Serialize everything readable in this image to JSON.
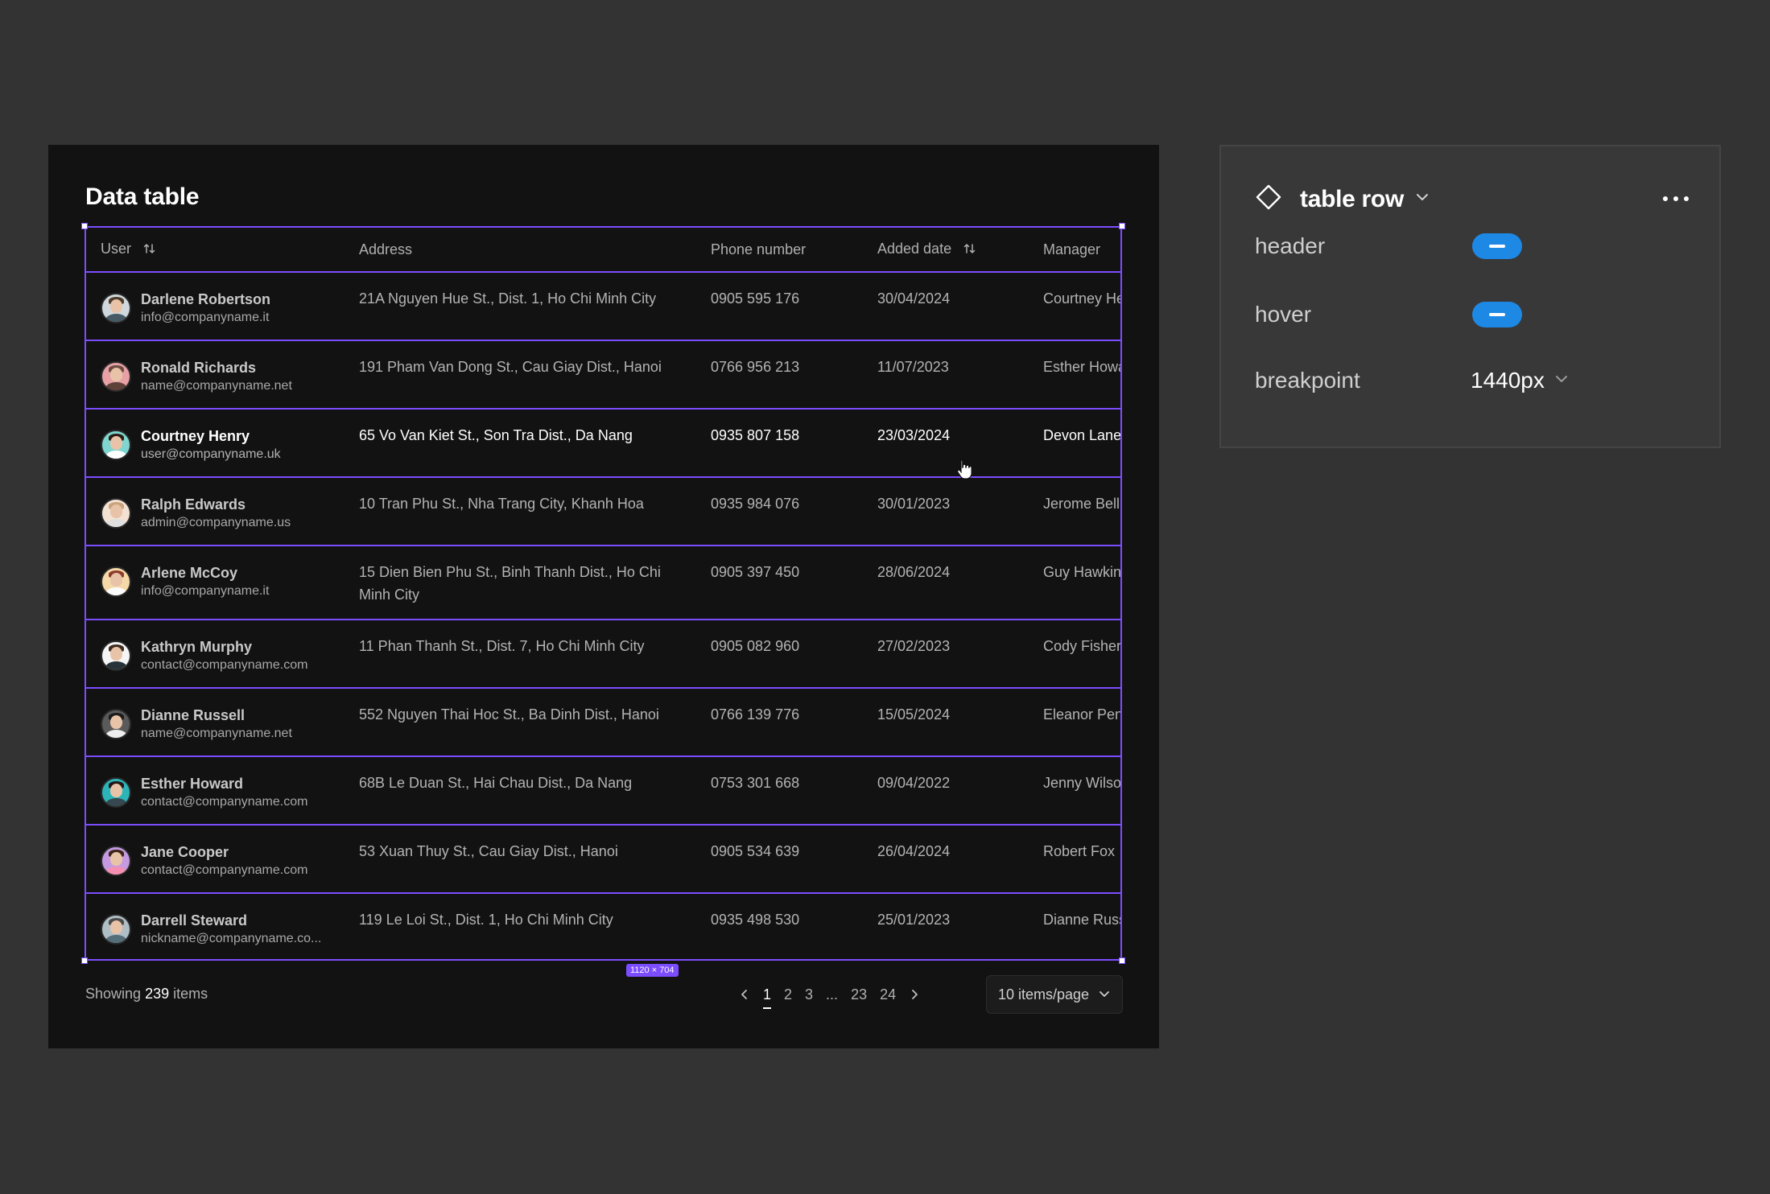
{
  "card": {
    "title": "Data table",
    "size_tag": "1120 × 704"
  },
  "table": {
    "columns": [
      "User",
      "Address",
      "Phone number",
      "Added date",
      "Manager"
    ],
    "sortable_columns": [
      "User",
      "Added date"
    ],
    "rows": [
      {
        "name": "Darlene Robertson",
        "email": "info@companyname.it",
        "address": "21A Nguyen Hue St., Dist. 1, Ho Chi Minh City",
        "phone": "0905 595 176",
        "date": "30/04/2024",
        "manager": "Courtney Henry"
      },
      {
        "name": "Ronald Richards",
        "email": "name@companyname.net",
        "address": "191 Pham Van Dong St., Cau Giay Dist., Hanoi",
        "phone": "0766 956 213",
        "date": "11/07/2023",
        "manager": "Esther Howard"
      },
      {
        "name": "Courtney Henry",
        "email": "user@companyname.uk",
        "address": "65 Vo Van Kiet St., Son Tra Dist., Da Nang",
        "phone": "0935 807 158",
        "date": "23/03/2024",
        "manager": "Devon Lane"
      },
      {
        "name": "Ralph Edwards",
        "email": "admin@companyname.us",
        "address": "10 Tran Phu St., Nha Trang City, Khanh Hoa",
        "phone": "0935 984 076",
        "date": "30/01/2023",
        "manager": "Jerome Bell"
      },
      {
        "name": "Arlene McCoy",
        "email": "info@companyname.it",
        "address": "15 Dien Bien Phu St., Binh Thanh Dist., Ho Chi Minh City",
        "phone": "0905 397 450",
        "date": "28/06/2024",
        "manager": "Guy Hawkins"
      },
      {
        "name": "Kathryn Murphy",
        "email": "contact@companyname.com",
        "address": "11 Phan Thanh St., Dist. 7, Ho Chi Minh City",
        "phone": "0905 082 960",
        "date": "27/02/2023",
        "manager": "Cody Fisher"
      },
      {
        "name": "Dianne Russell",
        "email": "name@companyname.net",
        "address": "552 Nguyen Thai Hoc St., Ba Dinh Dist., Hanoi",
        "phone": "0766 139 776",
        "date": "15/05/2024",
        "manager": "Eleanor Pena"
      },
      {
        "name": "Esther Howard",
        "email": "contact@companyname.com",
        "address": "68B Le Duan St., Hai Chau Dist., Da Nang",
        "phone": "0753 301 668",
        "date": "09/04/2022",
        "manager": "Jenny Wilson"
      },
      {
        "name": "Jane Cooper",
        "email": "contact@companyname.com",
        "address": "53 Xuan Thuy St., Cau Giay Dist., Hanoi",
        "phone": "0905 534 639",
        "date": "26/04/2024",
        "manager": "Robert Fox"
      },
      {
        "name": "Darrell Steward",
        "email": "nickname@companyname.co...",
        "address": "119 Le Loi St., Dist. 1, Ho Chi Minh City",
        "phone": "0935 498 530",
        "date": "25/01/2023",
        "manager": "Dianne Russell"
      }
    ]
  },
  "footer": {
    "showing_prefix": "Showing",
    "showing_count": "239",
    "showing_suffix": "items",
    "pages": [
      "1",
      "2",
      "3",
      "...",
      "23",
      "24"
    ],
    "current_page": "1",
    "per_page": "10 items/page"
  },
  "panel": {
    "title": "table row",
    "props": [
      {
        "label": "header",
        "type": "toggle"
      },
      {
        "label": "hover",
        "type": "toggle"
      },
      {
        "label": "breakpoint",
        "type": "select",
        "value": "1440px"
      }
    ]
  },
  "colors": {
    "background": "#333333",
    "card": "#121212",
    "selection": "#7c4dff",
    "toggle": "#1e88e5",
    "panel": "#383838"
  },
  "icons": {
    "sort": "sort-arrows-icon",
    "component": "component-diamond-icon",
    "caret": "chevron-down-icon",
    "more": "more-horizontal-icon",
    "prev": "chevron-left-icon",
    "next": "chevron-right-icon"
  }
}
